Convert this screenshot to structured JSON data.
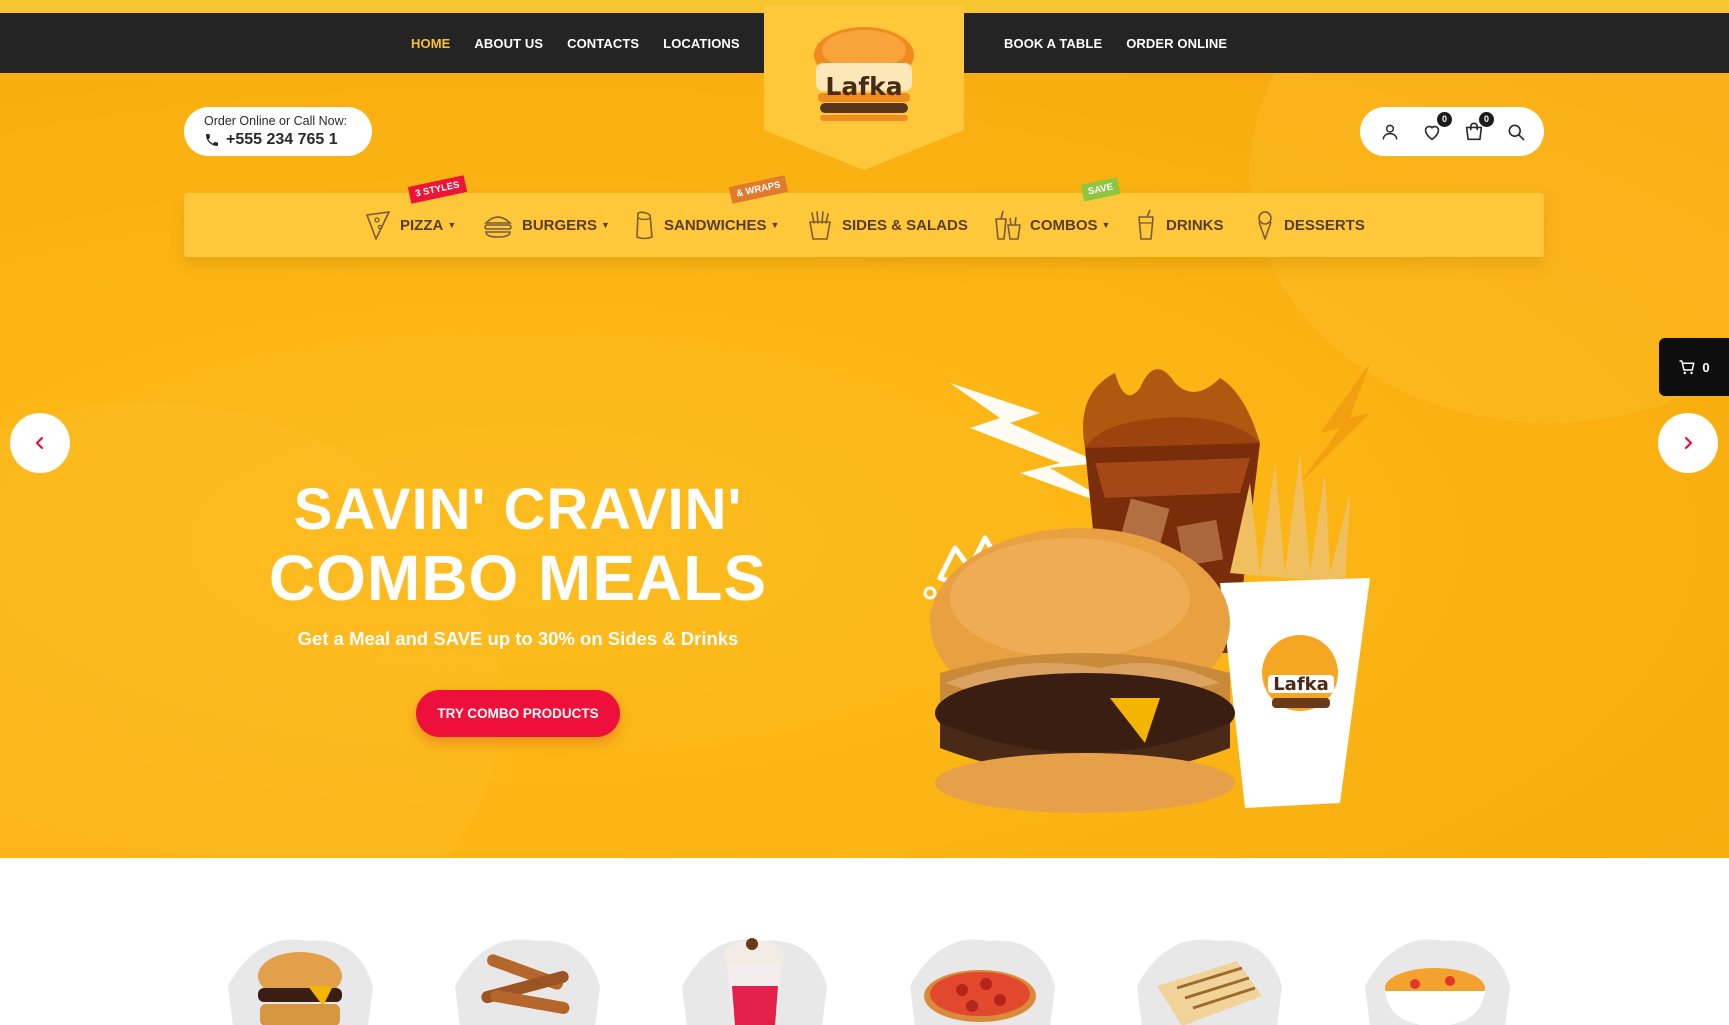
{
  "brand": {
    "logo_text": "Lafka"
  },
  "top_nav_left": [
    {
      "label": "HOME",
      "active": true
    },
    {
      "label": "ABOUT US"
    },
    {
      "label": "CONTACTS"
    },
    {
      "label": "LOCATIONS"
    }
  ],
  "top_nav_right": [
    {
      "label": "BOOK A TABLE"
    },
    {
      "label": "ORDER ONLINE"
    }
  ],
  "contact": {
    "caption": "Order Online or Call Now:",
    "phone": "+555 234 765 1",
    "icon": "phone-icon"
  },
  "header_icons": {
    "account": {
      "icon": "user-icon"
    },
    "wishlist": {
      "icon": "heart-icon",
      "count": "0"
    },
    "cart": {
      "icon": "shopping-bag-icon",
      "count": "0"
    },
    "search": {
      "icon": "search-icon"
    }
  },
  "categories": [
    {
      "label": "PIZZA",
      "icon": "pizza-icon",
      "has_dropdown": true,
      "tag": "3 STYLES",
      "tag_color": "#ee1438"
    },
    {
      "label": "BURGERS",
      "icon": "burger-icon",
      "has_dropdown": true
    },
    {
      "label": "SANDWICHES",
      "icon": "wrap-icon",
      "has_dropdown": true,
      "tag": "& WRAPS",
      "tag_color": "#e07a2c"
    },
    {
      "label": "SIDES & SALADS",
      "icon": "fries-icon",
      "has_dropdown": false
    },
    {
      "label": "COMBOS",
      "icon": "combo-icon",
      "has_dropdown": true,
      "tag": "SAVE",
      "tag_color": "#8dc63f"
    },
    {
      "label": "DRINKS",
      "icon": "drink-icon",
      "has_dropdown": false
    },
    {
      "label": "DESSERTS",
      "icon": "ice-cream-icon",
      "has_dropdown": false
    }
  ],
  "hero": {
    "title_line_1": "SAVIN' CRAVIN'",
    "title_line_2": "COMBO MEALS",
    "subtitle": "Get a Meal and SAVE up to 30% on Sides & Drinks",
    "cta_label": "TRY COMBO PRODUCTS"
  },
  "floating_cart": {
    "count": "0",
    "icon": "cart-icon"
  },
  "slider": {
    "prev_icon": "chevron-left-icon",
    "next_icon": "chevron-right-icon"
  },
  "colors": {
    "accent_yellow": "#f8c230",
    "dark_bar": "#242424",
    "cta_red": "#ee0f3a",
    "hero_bg": "#fbb514"
  },
  "thumbnails": [
    {
      "icon": "burger-thumb"
    },
    {
      "icon": "churros-thumb"
    },
    {
      "icon": "milkshake-thumb"
    },
    {
      "icon": "pizza-thumb"
    },
    {
      "icon": "panini-thumb"
    },
    {
      "icon": "mac-cheese-thumb"
    }
  ]
}
